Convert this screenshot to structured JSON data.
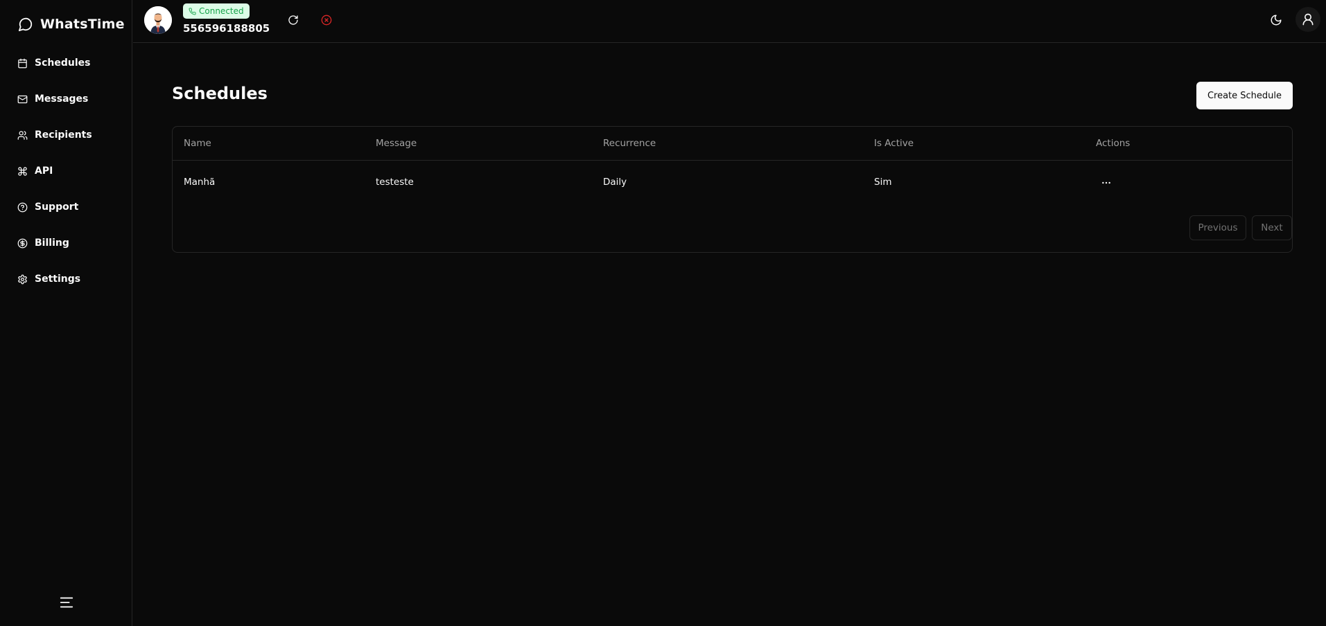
{
  "app": {
    "name": "WhatsTime"
  },
  "sidebar": {
    "items": [
      {
        "label": "Schedules",
        "icon": "calendar-icon"
      },
      {
        "label": "Messages",
        "icon": "mail-icon"
      },
      {
        "label": "Recipients",
        "icon": "users-icon"
      },
      {
        "label": "API",
        "icon": "command-icon"
      },
      {
        "label": "Support",
        "icon": "help-circle-icon"
      },
      {
        "label": "Billing",
        "icon": "dollar-circle-icon"
      },
      {
        "label": "Settings",
        "icon": "gear-icon"
      }
    ]
  },
  "topbar": {
    "status": "Connected",
    "phone": "556596188805",
    "colors": {
      "status_bg": "#dcfce7",
      "status_text": "#16a34a",
      "disconnect": "#dc2626"
    }
  },
  "page": {
    "title": "Schedules",
    "create_label": "Create Schedule"
  },
  "table": {
    "columns": [
      "Name",
      "Message",
      "Recurrence",
      "Is Active",
      "Actions"
    ],
    "rows": [
      {
        "name": "Manhã",
        "message": "testeste",
        "recurrence": "Daily",
        "is_active": "Sim"
      }
    ]
  },
  "pagination": {
    "previous": "Previous",
    "next": "Next"
  }
}
